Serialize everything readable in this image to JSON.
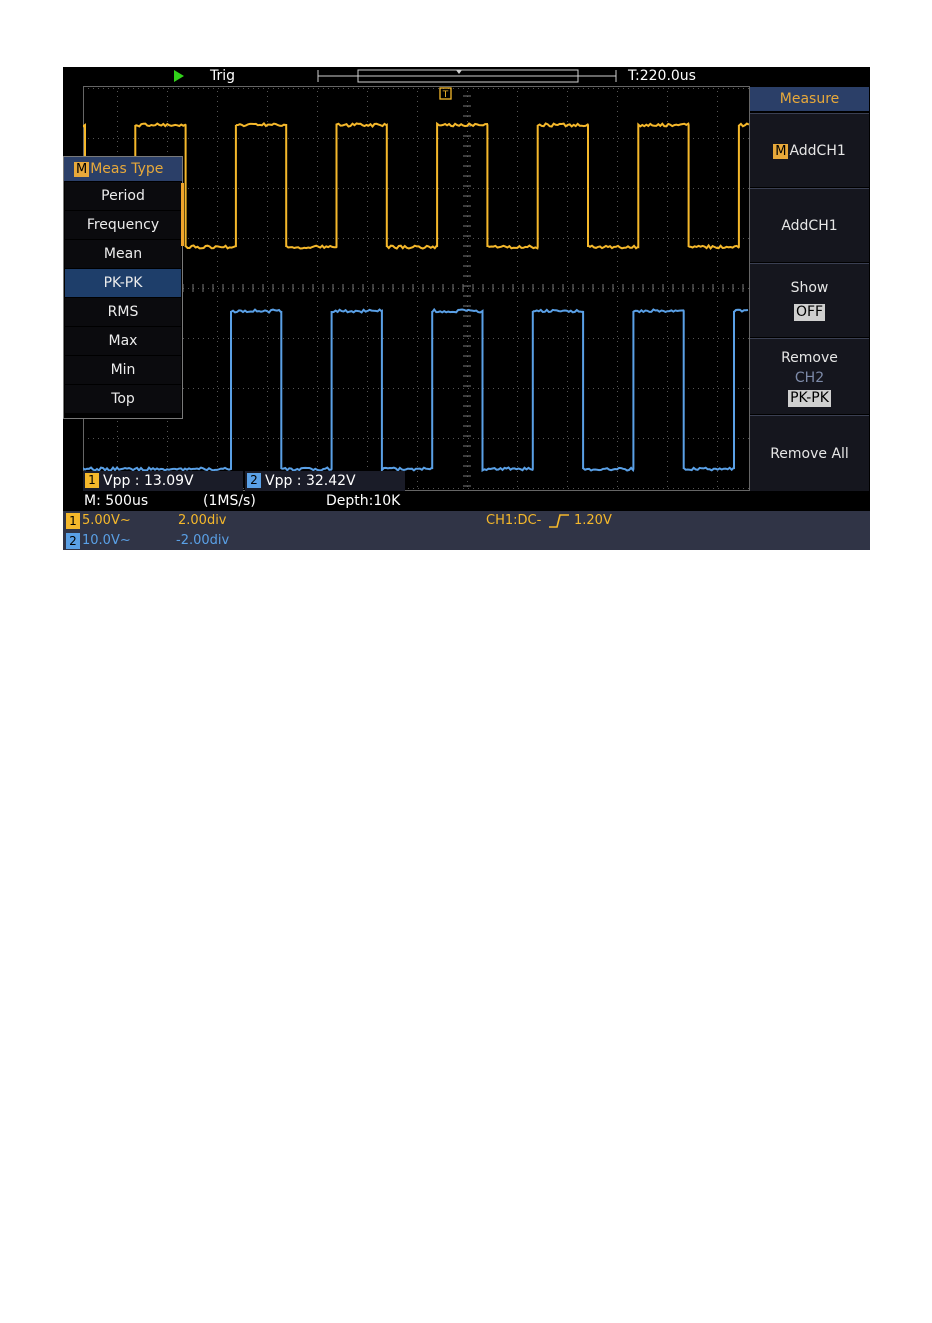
{
  "top_bar": {
    "run_state_icon": "play-icon",
    "trigger_status": "Trig",
    "time_offset": "T:220.0us"
  },
  "colors": {
    "ch1": "#f5b82b",
    "ch2": "#5aa0e6",
    "accent": "#e8a93a",
    "panel_title_bg": "#2b3f68"
  },
  "measure_menu": {
    "title": "Measure",
    "buttons": [
      {
        "badge": "M",
        "label": "AddCH1"
      },
      {
        "label": "AddCH1"
      },
      {
        "label": "Show",
        "value": "OFF"
      },
      {
        "label": "Remove",
        "sublabel": "CH2",
        "value": "PK-PK"
      },
      {
        "label": "Remove All"
      }
    ]
  },
  "meas_type_popup": {
    "badge": "M",
    "title": "Meas Type",
    "items": [
      "Period",
      "Frequency",
      "Mean",
      "PK-PK",
      "RMS",
      "Max",
      "Min",
      "Top"
    ],
    "selected": "PK-PK"
  },
  "measurements": [
    {
      "channel": "1",
      "text": "Vpp : 13.09V"
    },
    {
      "channel": "2",
      "text": "Vpp : 32.42V"
    }
  ],
  "status": {
    "timebase": "M: 500us",
    "sample_rate": "(1MS/s)",
    "depth": "Depth:10K",
    "ch1_badge": "1",
    "ch1_scale": "5.00V~",
    "ch1_offset": "2.00div",
    "ch2_badge": "2",
    "ch2_scale": "10.0V~",
    "ch2_offset": "-2.00div",
    "trigger_source": "CH1:DC-",
    "trigger_slope_icon": "rising-edge-icon",
    "trigger_level": "1.20V"
  }
}
